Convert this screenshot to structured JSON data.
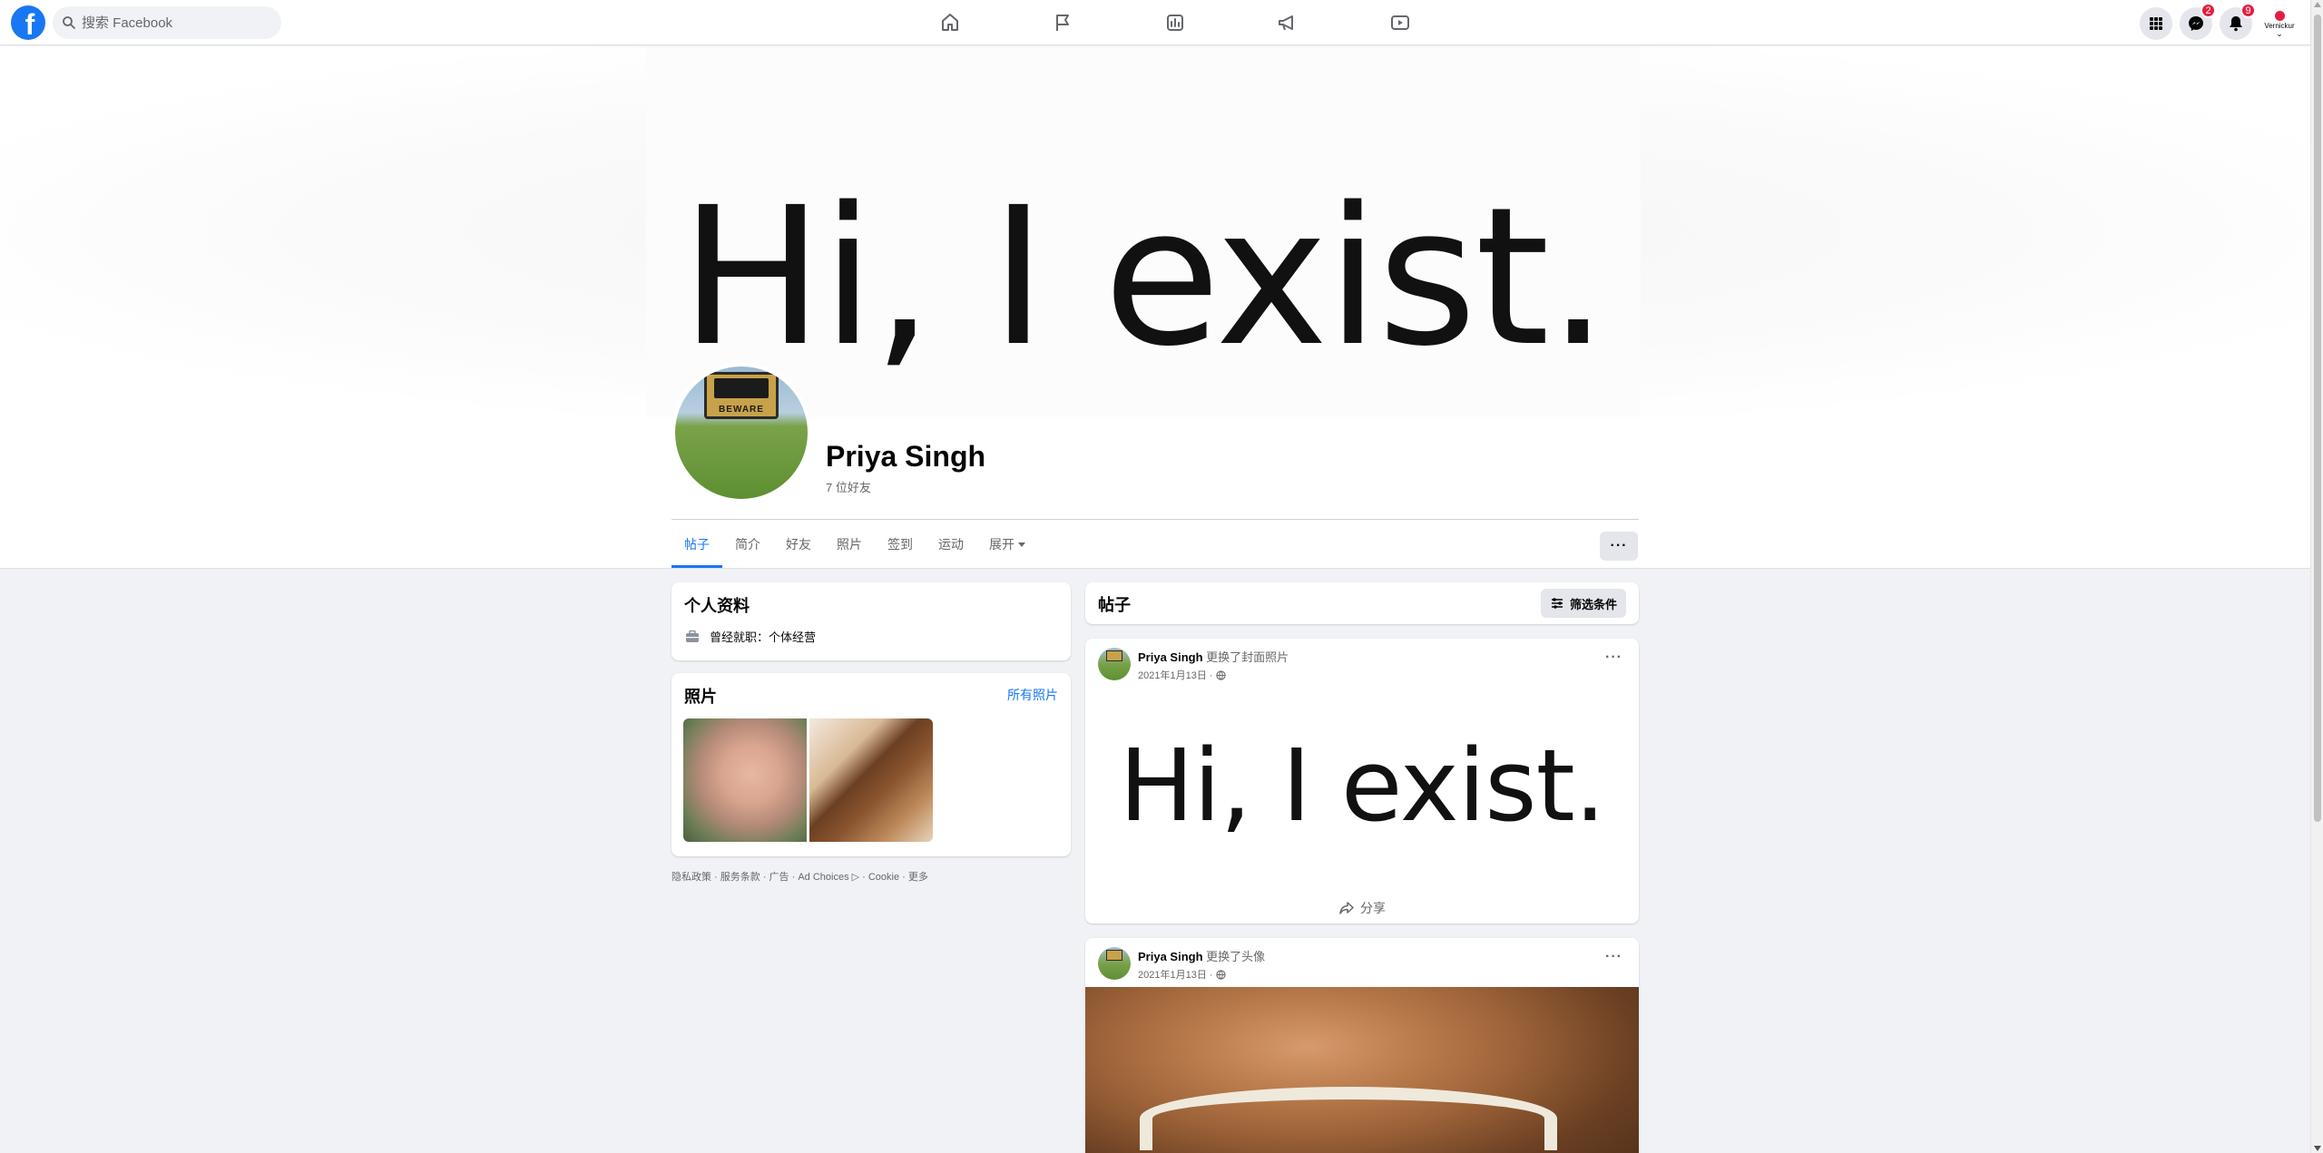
{
  "topnav": {
    "logo_letter": "f",
    "search_placeholder": "搜索 Facebook",
    "messenger_badge": "2",
    "notifications_badge": "9",
    "account_label": "Vernickur",
    "icons": [
      "home-icon",
      "flag-icon",
      "marketplace-icon",
      "megaphone-icon",
      "video-icon"
    ]
  },
  "cover": {
    "text": "Hi, I exist."
  },
  "profile": {
    "name": "Priya Singh",
    "friends": "7 位好友",
    "avatar_sign": "BEWARE",
    "tabs": [
      "帖子",
      "简介",
      "好友",
      "照片",
      "签到",
      "运动",
      "展开"
    ],
    "more_label": "···"
  },
  "intro": {
    "title": "个人资料",
    "work": "曾经就职：个体经营"
  },
  "photos": {
    "title": "照片",
    "all_link": "所有照片"
  },
  "footer": {
    "links": "隐私政策 · 服务条款 · 广告 · Ad Choices ▷ · Cookie · 更多"
  },
  "posts": {
    "title": "帖子",
    "filter_label": "筛选条件",
    "items": [
      {
        "author": "Priya Singh",
        "action": "更换了封面照片",
        "date": "2021年1月13日 · ",
        "image_text": "Hi, I exist.",
        "share": "分享"
      },
      {
        "author": "Priya Singh",
        "action": "更换了头像",
        "date": "2021年1月13日 · "
      }
    ],
    "dots": "···"
  },
  "colors": {
    "brand": "#1877f2",
    "badge": "#e41e3f",
    "background": "#f0f2f5"
  }
}
